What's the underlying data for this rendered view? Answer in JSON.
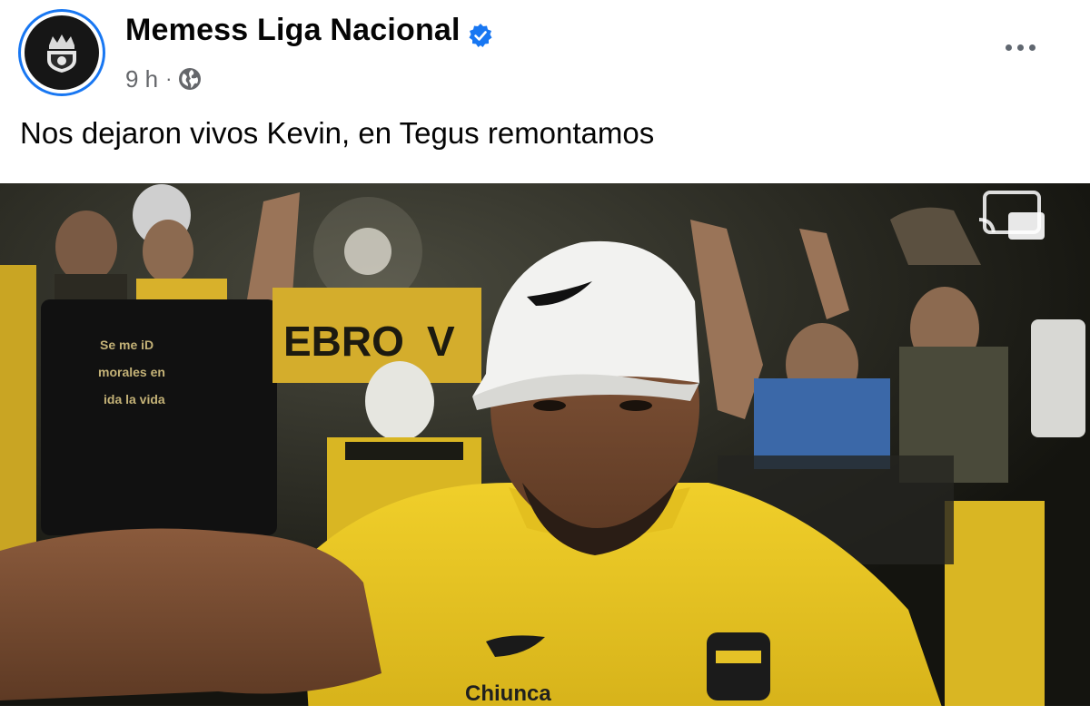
{
  "post": {
    "page_name": "Memess Liga Nacional",
    "verified": true,
    "timestamp": "9 h",
    "separator": "·",
    "audience_icon": "globe-icon",
    "more_icon": "more-options-icon",
    "text": "Nos dejaron vivos Kevin, en Tegus remontamos"
  },
  "media": {
    "type": "video-frame",
    "cast_icon": "cast-icon"
  },
  "colors": {
    "verified_blue": "#1877f2",
    "avatar_ring": "#1877f2",
    "jersey_yellow": "#e8c61e",
    "meta_gray": "#65676b"
  }
}
